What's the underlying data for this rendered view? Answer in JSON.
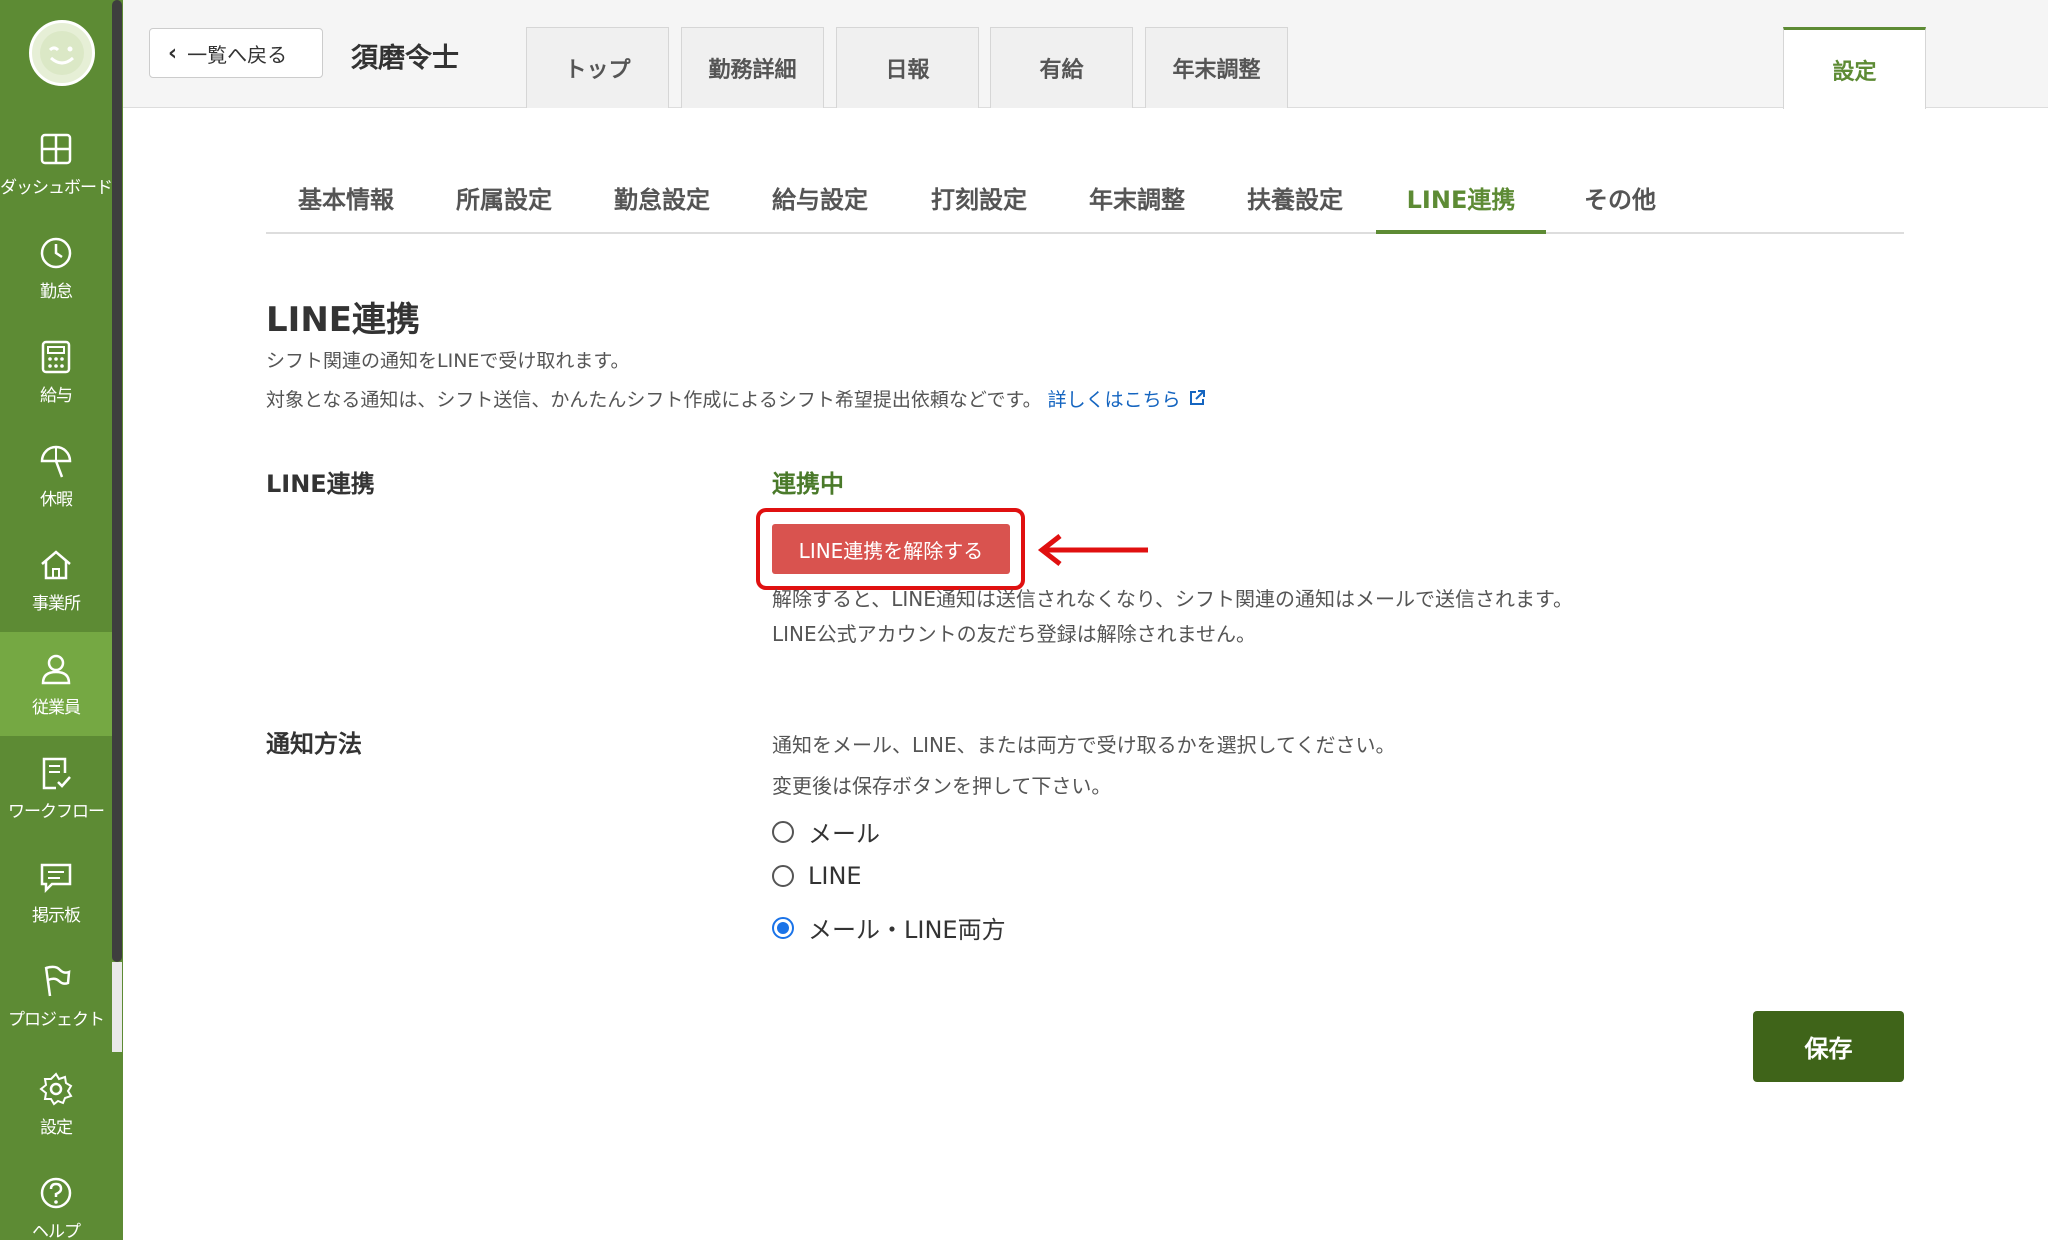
{
  "sidebar": {
    "items": [
      {
        "label": "ダッシュボード",
        "icon": "dashboard-icon"
      },
      {
        "label": "勤怠",
        "icon": "clock-icon"
      },
      {
        "label": "給与",
        "icon": "calculator-icon"
      },
      {
        "label": "休暇",
        "icon": "beach-umbrella-icon"
      },
      {
        "label": "事業所",
        "icon": "home-icon"
      },
      {
        "label": "従業員",
        "icon": "user-icon"
      },
      {
        "label": "ワークフロー",
        "icon": "checklist-icon"
      },
      {
        "label": "掲示板",
        "icon": "message-icon"
      },
      {
        "label": "プロジェクト",
        "icon": "flag-icon"
      },
      {
        "label": "設定",
        "icon": "gear-icon"
      },
      {
        "label": "ヘルプ",
        "icon": "help-icon"
      }
    ],
    "active_item": "従業員"
  },
  "header": {
    "back_label": "一覧へ戻る",
    "employee_name": "須磨令士",
    "tabs": [
      "トップ",
      "勤務詳細",
      "日報",
      "有給",
      "年末調整"
    ],
    "settings_tab": "設定"
  },
  "subtabs": [
    "基本情報",
    "所属設定",
    "勤怠設定",
    "給与設定",
    "打刻設定",
    "年末調整",
    "扶養設定",
    "LINE連携",
    "その他"
  ],
  "active_subtab": "LINE連携",
  "main": {
    "title": "LINE連携",
    "desc1": "シフト関連の通知をLINEで受け取れます。",
    "desc2": "対象となる通知は、シフト送信、かんたんシフト作成によるシフト希望提出依頼などです。",
    "desc_link": "詳しくはこちら",
    "line_section": {
      "label": "LINE連携",
      "status": "連携中",
      "unlink_button": "LINE連携を解除する",
      "note1": "解除すると、LINE通知は送信されなくなり、シフト関連の通知はメールで送信されます。",
      "note2": "LINE公式アカウントの友だち登録は解除されません。"
    },
    "notify_section": {
      "label": "通知方法",
      "desc1": "通知をメール、LINE、または両方で受け取るかを選択してください。",
      "desc2": "変更後は保存ボタンを押して下さい。",
      "options": [
        "メール",
        "LINE",
        "メール・LINE両方"
      ],
      "selected": "メール・LINE両方"
    },
    "save_label": "保存"
  },
  "colors": {
    "sidebar": "#5d8b34",
    "accent_green": "#5d8b34",
    "danger": "#d9534f",
    "highlight_red": "#e01010",
    "save_button": "#3f6419",
    "link": "#1565c0"
  }
}
